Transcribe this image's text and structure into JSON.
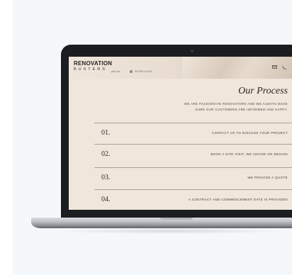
{
  "brand": {
    "name": "RENOVATION",
    "sub": "BUSTERS"
  },
  "partners": [
    "jelly bac",
    "SILVER GLASS"
  ],
  "header_icons": [
    "mail-icon",
    "phone-icon"
  ],
  "page": {
    "title": "Our Process",
    "intro_line1": "WE ARE PASSIONATE RENOVATORS AND WE ALWAYS MAKE",
    "intro_line2": "SURE OUR CUSTOMERS ARE INFORMED AND HAPPY."
  },
  "steps": [
    {
      "number": "01.",
      "text": "CONTACT US TO DISCUSS YOUR PROJECT"
    },
    {
      "number": "02.",
      "text": "BOOK A SITE VISIT, WE ADVISE ON DESIGN"
    },
    {
      "number": "03.",
      "text": "WE PROVIDE A QUOTE"
    },
    {
      "number": "04.",
      "text": "A CONTRACT AND COMMENCEMENT DATE IS PROVIDED"
    }
  ]
}
